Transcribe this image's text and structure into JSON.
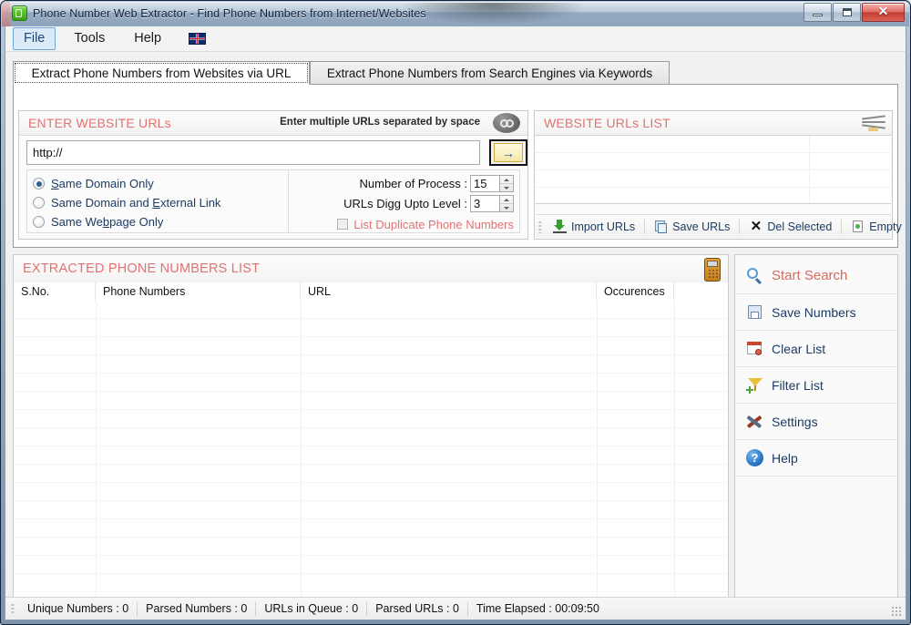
{
  "window": {
    "title": "Phone Number Web Extractor - Find Phone Numbers from Internet/Websites",
    "app_icon": "phone-app-icon",
    "buttons": {
      "minimize": "minimize-icon",
      "maximize": "maximize-icon",
      "close": "✕"
    }
  },
  "menubar": {
    "items": [
      {
        "label": "File",
        "active": true
      },
      {
        "label": "Tools",
        "active": false
      },
      {
        "label": "Help",
        "active": false
      }
    ],
    "flag_icon": "uk-flag-icon"
  },
  "tabs": [
    {
      "label": "Extract Phone Numbers from Websites via URL",
      "selected": true
    },
    {
      "label": "Extract Phone Numbers from Search Engines via Keywords",
      "selected": false
    }
  ],
  "enter_urls": {
    "title": "ENTER WEBSITE URLs",
    "hint": "Enter multiple URLs separated by space",
    "link_icon": "chain-link-icon",
    "url_value": "http://",
    "go_button": "→",
    "radios": [
      {
        "label": "Same Domain Only",
        "mnemonic": "S",
        "selected": true
      },
      {
        "label": "Same Domain and External Link",
        "mnemonic": "E",
        "selected": false
      },
      {
        "label": "Same Webpage Only",
        "mnemonic": "b",
        "selected": false
      }
    ],
    "spinners": [
      {
        "label": "Number of Process :",
        "value": "15"
      },
      {
        "label": "URLs Digg Upto Level :",
        "value": "3"
      }
    ],
    "checkbox": {
      "label": "List Duplicate Phone Numbers",
      "checked": false
    }
  },
  "urls_list": {
    "title": "WEBSITE URLs LIST",
    "header_icon": "globe-network-icon",
    "rows": [],
    "toolbar": [
      {
        "label": "Import URLs",
        "icon": "import-icon"
      },
      {
        "label": "Save URLs",
        "icon": "save-icon"
      },
      {
        "label": "Del Selected",
        "icon": "delete-x-icon"
      },
      {
        "label": "Empty",
        "icon": "empty-icon"
      }
    ]
  },
  "extracted": {
    "title": "EXTRACTED PHONE NUMBERS LIST",
    "header_icon": "mobile-phone-icon",
    "columns": [
      "S.No.",
      "Phone Numbers",
      "URL",
      "Occurences",
      ""
    ],
    "rows": []
  },
  "sidebar": {
    "items": [
      {
        "label": "Start Search",
        "icon": "search-icon"
      },
      {
        "label": "Save Numbers",
        "icon": "save-icon"
      },
      {
        "label": "Clear List",
        "icon": "clear-list-icon"
      },
      {
        "label": "Filter List",
        "icon": "filter-icon"
      },
      {
        "label": "Settings",
        "icon": "settings-icon"
      },
      {
        "label": "Help",
        "icon": "help-icon"
      }
    ]
  },
  "statusbar": {
    "items": [
      {
        "label": "Unique Numbers :  0"
      },
      {
        "label": "Parsed Numbers :  0"
      },
      {
        "label": "URLs in Queue :  0"
      },
      {
        "label": "Parsed URLs :  0"
      },
      {
        "label": "Time Elapsed :  00:09:50"
      }
    ]
  },
  "colors": {
    "accent_red": "#e27272",
    "link_blue": "#1b3b63",
    "title_blue": "#13233a",
    "close_red": "#c23a30"
  }
}
